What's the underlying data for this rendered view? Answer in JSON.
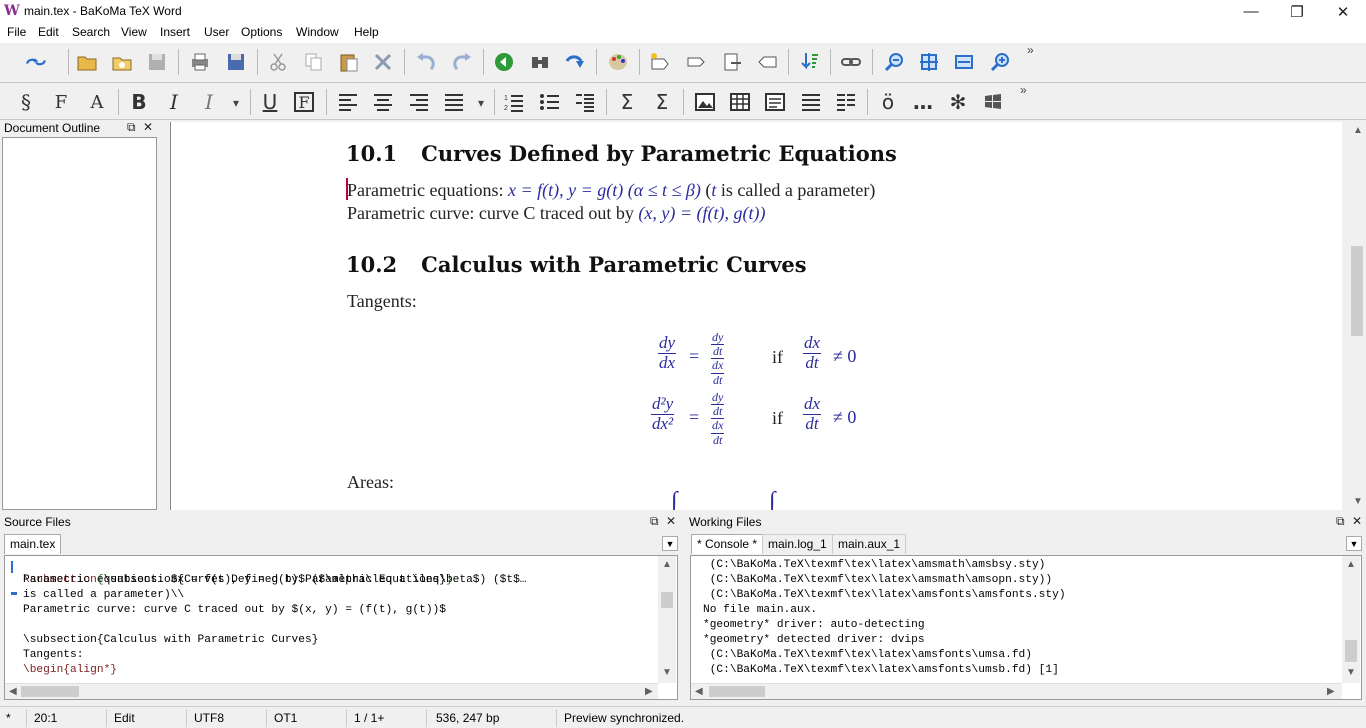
{
  "window": {
    "title": "main.tex - BaKoMa TeX Word"
  },
  "menu": [
    "File",
    "Edit",
    "Search",
    "View",
    "Insert",
    "User",
    "Options",
    "Window",
    "Help"
  ],
  "outline": {
    "title": "Document Outline"
  },
  "preview": {
    "sec1_num": "10.1",
    "sec1_title": "Curves Defined by Parametric Equations",
    "line1_text": "Parametric equations: ",
    "line1_math": "x = f(t), y = g(t)",
    "line1_paren_math": "(α ≤ t ≤ β)",
    "line1_tail1": " (",
    "line1_t": "t",
    "line1_tail2": " is called a parameter)",
    "line2_text": "Parametric curve: curve C traced out by ",
    "line2_math": "(x, y) = (f(t), g(t))",
    "sec2_num": "10.2",
    "sec2_title": "Calculus with Parametric Curves",
    "tangents": "Tangents:",
    "areas": "Areas:",
    "if": "if",
    "neq0": "≠ 0",
    "dy": "dy",
    "dx": "dx",
    "dt": "dt",
    "d2y": "d²y",
    "dx2": "dx²"
  },
  "source": {
    "title": "Source Files",
    "tab": "main.tex",
    "lines": [
      "\\subsection{Curves Defined by Parametric Equations}",
      "Parametric equations: $x = f(t), y = g(t)$ ($\\alpha\\leq t \\leq\\beta$) ($t$…",
      "is called a parameter)\\\\",
      "Parametric curve: curve C traced out by $(x, y) = (f(t), g(t))$",
      "",
      "\\subsection{Calculus with Parametric Curves}",
      "Tangents:",
      "\\begin{align*}"
    ]
  },
  "working": {
    "title": "Working Files",
    "tabs": [
      "* Console *",
      "main.log_1",
      "main.aux_1"
    ],
    "lines": [
      " (C:\\BaKoMa.TeX\\texmf\\tex\\latex\\amsmath\\amsbsy.sty)",
      " (C:\\BaKoMa.TeX\\texmf\\tex\\latex\\amsmath\\amsopn.sty))",
      " (C:\\BaKoMa.TeX\\texmf\\tex\\latex\\amsfonts\\amsfonts.sty)",
      "No file main.aux.",
      "*geometry* driver: auto-detecting",
      "*geometry* detected driver: dvips",
      " (C:\\BaKoMa.TeX\\texmf\\tex\\latex\\amsfonts\\umsa.fd)",
      " (C:\\BaKoMa.TeX\\texmf\\tex\\latex\\amsfonts\\umsb.fd) [1]"
    ]
  },
  "status": {
    "star": "*",
    "position": "20:1",
    "mode": "Edit",
    "encoding": "UTF8",
    "fontenc": "OT1",
    "pages": "1 / 1+",
    "coords": "536, 247 bp",
    "message": "Preview synchronized."
  },
  "colors": {
    "math": "#2b2b9e",
    "keyword": "#7a1f1f",
    "brace": "#1a7a1a",
    "cursor": "#c0003c"
  }
}
